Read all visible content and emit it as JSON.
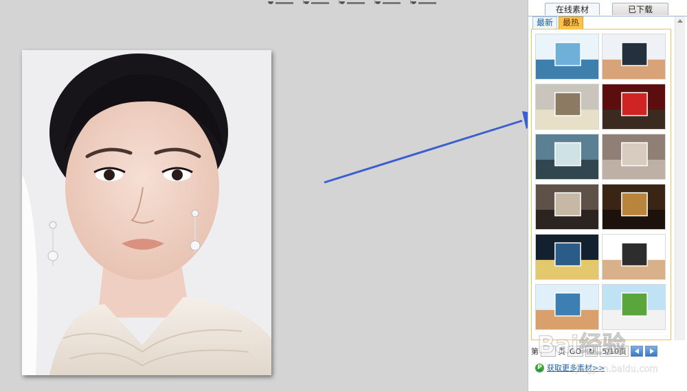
{
  "panel": {
    "tabs": [
      {
        "label": "在线素材",
        "active": true
      },
      {
        "label": "已下载",
        "active": false
      }
    ],
    "subtabs": [
      {
        "label": "最新",
        "active": false
      },
      {
        "label": "最热",
        "active": true
      }
    ],
    "pager": {
      "first_label": "第",
      "page_label": "页",
      "go_label": "GO",
      "page_info": "5/10页"
    },
    "more_link": "获取更多素材>>"
  },
  "thumbnails": [
    {
      "name": "thumb-film-strip-scene",
      "colors": [
        "#e9f4fb",
        "#6fb0d8",
        "#3f7fae"
      ]
    },
    {
      "name": "thumb-hand-holding-photo",
      "colors": [
        "#eef2f6",
        "#24303c",
        "#d9a37a"
      ]
    },
    {
      "name": "thumb-lightbox-in-hall",
      "colors": [
        "#c9c5bc",
        "#8b7b63",
        "#e8dfc8"
      ]
    },
    {
      "name": "thumb-red-home-theater",
      "colors": [
        "#5c0d0d",
        "#d02323",
        "#3a2a20"
      ]
    },
    {
      "name": "thumb-outdoor-billboard",
      "colors": [
        "#5b7f93",
        "#cfe3e6",
        "#31464f"
      ]
    },
    {
      "name": "thumb-wall-projection",
      "colors": [
        "#8f7f74",
        "#d8cbbf",
        "#bfb0a5"
      ]
    },
    {
      "name": "thumb-photo-collage",
      "colors": [
        "#5d5148",
        "#c7b8a6",
        "#2b2420"
      ]
    },
    {
      "name": "thumb-gold-frame-room",
      "colors": [
        "#3a2414",
        "#b9853c",
        "#1c120b"
      ]
    },
    {
      "name": "thumb-night-street-board",
      "colors": [
        "#12202f",
        "#2b5b87",
        "#e3c86d"
      ]
    },
    {
      "name": "thumb-frame-with-lamp",
      "colors": [
        "#ffffff",
        "#2d2d2d",
        "#d8b08a"
      ]
    },
    {
      "name": "thumb-cheering-crowd",
      "colors": [
        "#dff0fb",
        "#3e7fb3",
        "#d9a06b"
      ]
    },
    {
      "name": "thumb-green-field-album",
      "colors": [
        "#bfe3f4",
        "#5aa53c",
        "#f2f2f2"
      ]
    }
  ],
  "watermark": {
    "text": "Bai经验",
    "sub": "jingyan.baidu.com"
  },
  "colors": {
    "accent": "#1b5fa8",
    "arrow": "#3b5fcf",
    "hot_tab": "#ffc24b"
  }
}
